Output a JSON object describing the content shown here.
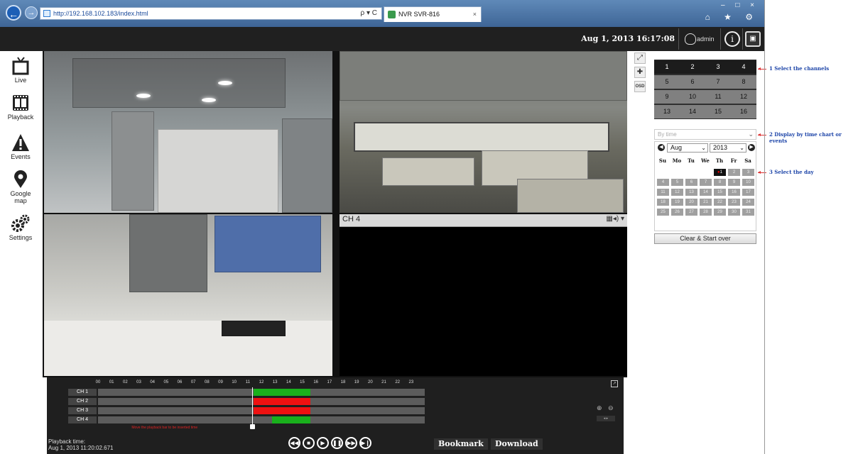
{
  "browser": {
    "url": "http://192.168.102.183/index.html",
    "tab_title": "NVR SVR-816",
    "tab_close": "×",
    "back_glyph": "←",
    "forward_glyph": "→",
    "addr_tools": "ρ ▾ C",
    "window_controls": "– □ ×",
    "toolbar_icons": "⌂ ★ ⚙"
  },
  "header": {
    "datetime": "Aug 1, 2013 16:17:08",
    "user": "admin",
    "info_glyph": "i",
    "monitor_glyph": "▣"
  },
  "nav": [
    {
      "label": "Live",
      "icon": "tv-icon"
    },
    {
      "label": "Playback",
      "icon": "film-icon"
    },
    {
      "label": "Events",
      "icon": "warning-icon"
    },
    {
      "label": "Google map",
      "icon": "map-pin-icon"
    },
    {
      "label": "Settings",
      "icon": "gears-icon"
    }
  ],
  "video": {
    "tools": {
      "fullscreen": "⤢",
      "ptz": "✚",
      "osd": "OSD"
    },
    "ch4": {
      "label": "CH 4",
      "icons": "▦◂) ▾"
    }
  },
  "channels": [
    "1",
    "2",
    "3",
    "4",
    "5",
    "6",
    "7",
    "8",
    "9",
    "10",
    "11",
    "12",
    "13",
    "14",
    "15",
    "16"
  ],
  "mode": {
    "value": "By time",
    "chevron": "⌄"
  },
  "calendar": {
    "month": "Aug",
    "year": "2013",
    "prev": "◀",
    "next": "▶",
    "chevron": "⌄",
    "dow": [
      "Su",
      "Mo",
      "Tu",
      "We",
      "Th",
      "Fr",
      "Sa"
    ],
    "weeks": [
      [
        "",
        "",
        "",
        "",
        "1",
        "2",
        "3"
      ],
      [
        "4",
        "5",
        "6",
        "7",
        "8",
        "9",
        "10"
      ],
      [
        "11",
        "12",
        "13",
        "14",
        "15",
        "16",
        "17"
      ],
      [
        "18",
        "19",
        "20",
        "21",
        "22",
        "23",
        "24"
      ],
      [
        "25",
        "26",
        "27",
        "28",
        "29",
        "30",
        "31"
      ]
    ],
    "selected_day": "1",
    "rec_mark": "●"
  },
  "clear_button": "Clear & Start over",
  "annotations": [
    "1 Select the channels",
    "2 Display by time chart or events",
    "3 Select the day"
  ],
  "timeline": {
    "hours": [
      "00",
      "01",
      "02",
      "03",
      "04",
      "05",
      "06",
      "07",
      "08",
      "09",
      "10",
      "11",
      "12",
      "13",
      "14",
      "15",
      "16",
      "17",
      "18",
      "19",
      "20",
      "21",
      "22",
      "23"
    ],
    "channels": [
      {
        "label": "CH 1",
        "segments": [
          {
            "from": 11.4,
            "to": 12.5,
            "type": "green"
          },
          {
            "from": 12.5,
            "to": 15.6,
            "type": "green"
          }
        ]
      },
      {
        "label": "CH 2",
        "segments": [
          {
            "from": 11.4,
            "to": 15.6,
            "type": "red"
          }
        ]
      },
      {
        "label": "CH 3",
        "segments": [
          {
            "from": 11.4,
            "to": 15.6,
            "type": "red"
          }
        ]
      },
      {
        "label": "CH 4",
        "segments": [
          {
            "from": 12.8,
            "to": 15.6,
            "type": "green"
          }
        ]
      }
    ],
    "cursor_hour": 11.34,
    "cursor_note": "Move the playback bar to be inserted time",
    "playback_label": "Playback time:",
    "playback_time": "Aug 1, 2013 11:20:02.671",
    "controls": [
      {
        "name": "rewind-button",
        "glyph": "◀◀"
      },
      {
        "name": "stop-button",
        "glyph": "■"
      },
      {
        "name": "play-button",
        "glyph": "▶"
      },
      {
        "name": "pause-button",
        "glyph": "❚❚"
      },
      {
        "name": "fast-forward-button",
        "glyph": "▶▶"
      },
      {
        "name": "next-frame-button",
        "glyph": "▶❙"
      }
    ],
    "bookmark": "Bookmark",
    "download": "Download",
    "zoom_in": "⊕",
    "zoom_out": "⊖",
    "popout": "↗",
    "scroll": "◂ ▸"
  },
  "colors": {
    "header_bg": "#202020",
    "seg_red": "#ee1111",
    "seg_green": "#19b01c",
    "annotation": "#1c44a8"
  }
}
